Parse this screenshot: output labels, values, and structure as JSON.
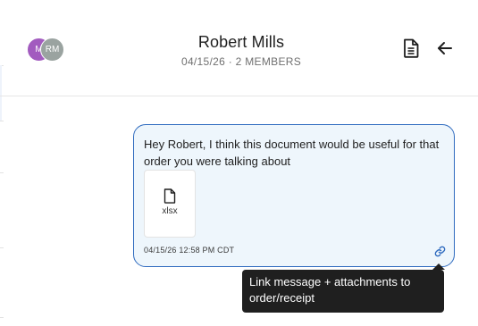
{
  "header": {
    "title": "Robert Mills",
    "subtitle": "04/15/26 · 2 MEMBERS",
    "members": [
      {
        "initials": "M",
        "color": "#a25bbf"
      },
      {
        "initials": "RM",
        "color": "#9aa3a0"
      }
    ],
    "actions": [
      {
        "icon": "document-icon"
      },
      {
        "icon": "back-arrow-icon"
      }
    ]
  },
  "message": {
    "text": "Hey Robert, I think this document would be useful for that order you were talking about",
    "attachment": {
      "icon": "file-icon",
      "extension": "xlsx"
    },
    "timestamp": "04/15/26 12:58 PM CDT",
    "link_icon": "link-icon"
  },
  "tooltip": {
    "text": "Link message + attachments to order/receipt"
  },
  "colors": {
    "bubble_border": "#2f6bbf",
    "bubble_background": "#eef6fc",
    "tooltip_background": "#1f1f1f",
    "link_icon": "#2f6bbf"
  }
}
